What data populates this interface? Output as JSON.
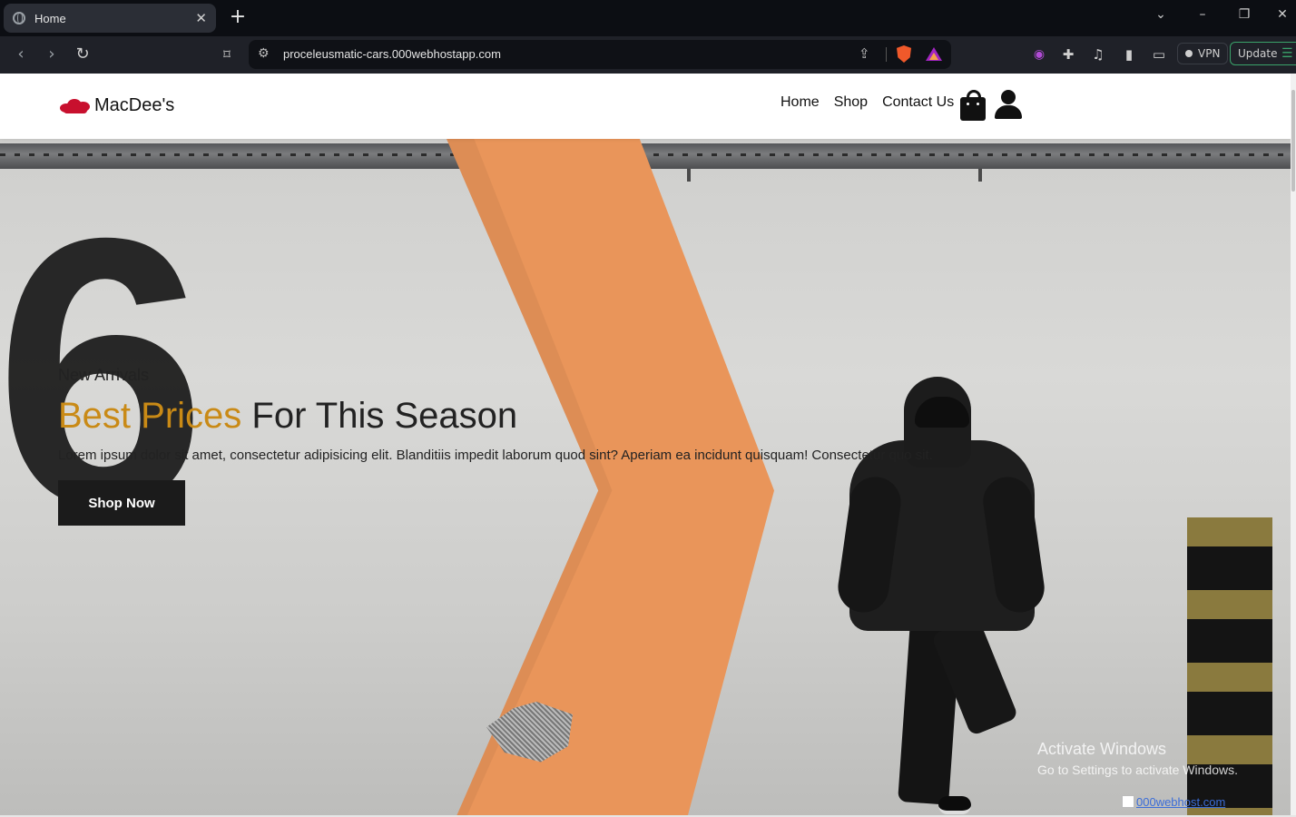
{
  "browser": {
    "tab_title": "Home",
    "tab_close": "✕",
    "new_tab": "+",
    "window_controls": [
      "⌄",
      "–",
      "❐",
      "✕"
    ],
    "url": "proceleusmatic-cars.000webhostapp.com",
    "vpn_label": "VPN",
    "update_label": "Update",
    "icons": [
      "back-icon",
      "forward-icon",
      "reload-icon",
      "bookmark-icon",
      "site-info-icon",
      "share-icon",
      "brave-shields-icon",
      "brave-rewards-icon",
      "wallet-icon",
      "extensions-icon",
      "media-icon",
      "sidebar-icon",
      "menu-icon"
    ]
  },
  "site": {
    "brand": "MacDee's",
    "nav": {
      "home": "Home",
      "shop": "Shop",
      "contact": "Contact Us"
    }
  },
  "hero": {
    "subtitle": "New Arrivals",
    "title_accent": "Best Prices",
    "title_rest": " For This Season",
    "description": "Lorem ipsum dolor sit amet, consectetur adipisicing elit. Blanditiis impedit laborum quod sint? Aperiam ea incidunt quisquam! Consectetur quo sit.",
    "cta": "Shop Now",
    "wall_number": "6",
    "accent_color": "#c98a16"
  },
  "overlay": {
    "activate_title": "Activate Windows",
    "activate_sub": "Go to Settings to activate Windows.",
    "host_link": "000webhost.com"
  }
}
